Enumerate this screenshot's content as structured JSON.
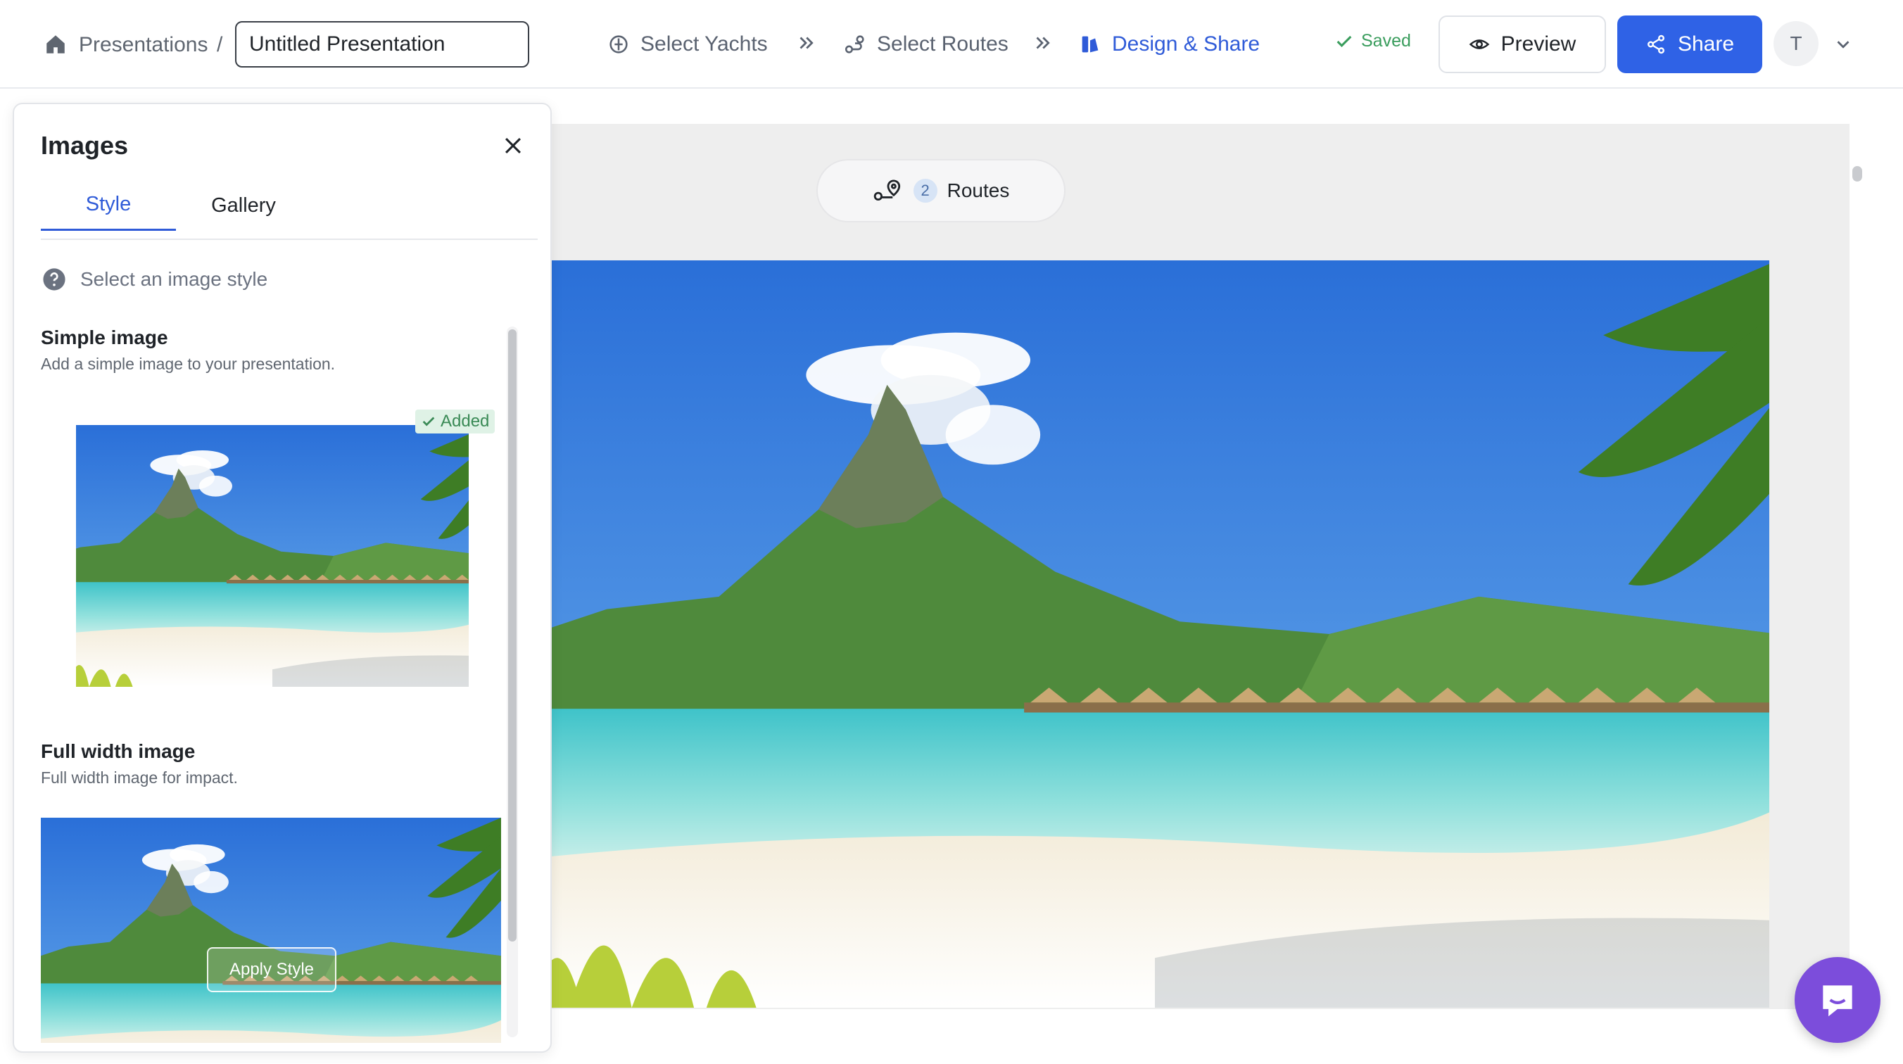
{
  "header": {
    "breadcrumb": "Presentations",
    "separator": "/",
    "title_value": "Untitled Presentation",
    "steps": [
      {
        "label": "Select Yachts",
        "icon": "yacht-icon",
        "active": false
      },
      {
        "label": "Select Routes",
        "icon": "route-icon",
        "active": false
      },
      {
        "label": "Design & Share",
        "icon": "design-icon",
        "active": true
      }
    ],
    "status": "Saved",
    "preview_label": "Preview",
    "share_label": "Share",
    "avatar_initial": "T"
  },
  "canvas": {
    "routes_count": "2",
    "routes_label": "Routes"
  },
  "images_panel": {
    "title": "Images",
    "tabs": [
      {
        "label": "Style",
        "active": true
      },
      {
        "label": "Gallery",
        "active": false
      }
    ],
    "hint": "Select an image style",
    "options": [
      {
        "title": "Simple image",
        "description": "Add a simple image to your presentation.",
        "badge": "Added"
      },
      {
        "title": "Full width image",
        "description": "Full width image for impact.",
        "action_label": "Apply Style"
      }
    ]
  },
  "colors": {
    "accent": "#2f62e6",
    "saved_green": "#3a9d5d",
    "chat_purple": "#7c4ddb"
  }
}
